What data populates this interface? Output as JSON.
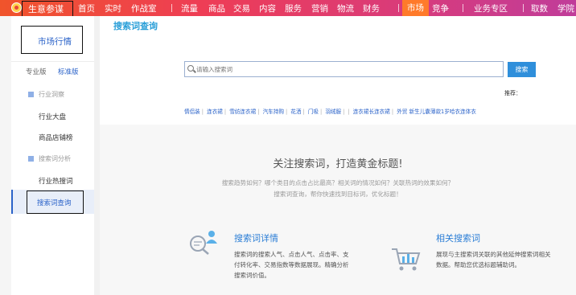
{
  "topnav": {
    "brand": "生意参谋",
    "items": [
      {
        "label": "首页"
      },
      {
        "label": "实时"
      },
      {
        "label": "作战室"
      },
      {
        "label": "流量"
      },
      {
        "label": "商品"
      },
      {
        "label": "交易"
      },
      {
        "label": "内容"
      },
      {
        "label": "服务"
      },
      {
        "label": "营销"
      },
      {
        "label": "物流"
      },
      {
        "label": "财务"
      },
      {
        "label": "市场",
        "active": true
      },
      {
        "label": "竞争"
      },
      {
        "label": "业务专区"
      },
      {
        "label": "取数"
      },
      {
        "label": "学院"
      }
    ]
  },
  "sidebar": {
    "title": "市场行情",
    "versions": {
      "pro": "专业版",
      "std": "标准版"
    },
    "groups": [
      {
        "label": "行业洞察",
        "items": [
          "行业大盘",
          "商品店铺榜"
        ]
      },
      {
        "label": "搜索词分析",
        "items": [
          "行业热搜词",
          "搜索词查询"
        ]
      }
    ],
    "active_item": "搜索词查询"
  },
  "page": {
    "title": "搜索词查询",
    "search": {
      "placeholder": "请输入搜索词",
      "button": "搜索"
    },
    "recommend_label": "推荐：",
    "hotwords": [
      "情侣装",
      "连衣裙",
      "雪纺连衣裙",
      "汽车持购",
      "花洒",
      "门吸",
      "羽绒服",
      "",
      "连衣裙长连衣裙",
      "外贸 新生儿囊薄款1岁哈衣连体衣"
    ],
    "headline": "关注搜索词，打造黄金标题!",
    "sub1": "搜索趋势如何？哪个类目的点击占比最高？相关词的情况如何？关联热词的效果如何？",
    "sub2": "搜索词查询，帮你快速找到目标词，优化标题！",
    "features": [
      {
        "title": "搜索词详情",
        "desc": [
          "搜索词的搜索人气、点击人气、点击率、支",
          "付转化率、交易指数等数据展现。精确分析",
          "搜索词价值。"
        ],
        "icon": "search-person-icon"
      },
      {
        "title": "相关搜索词",
        "desc": [
          "展现与主搜索词关联的其他延伸搜索词相关",
          "数据。帮助您优选标题辅助词。"
        ],
        "icon": "cart-chart-icon"
      }
    ]
  },
  "colors": {
    "accent": "#2b63c9",
    "topbar_from": "#f0542b",
    "topbar_to": "#c03c9a",
    "active_tab": "#ff7a2a",
    "button": "#2f8fdb"
  }
}
